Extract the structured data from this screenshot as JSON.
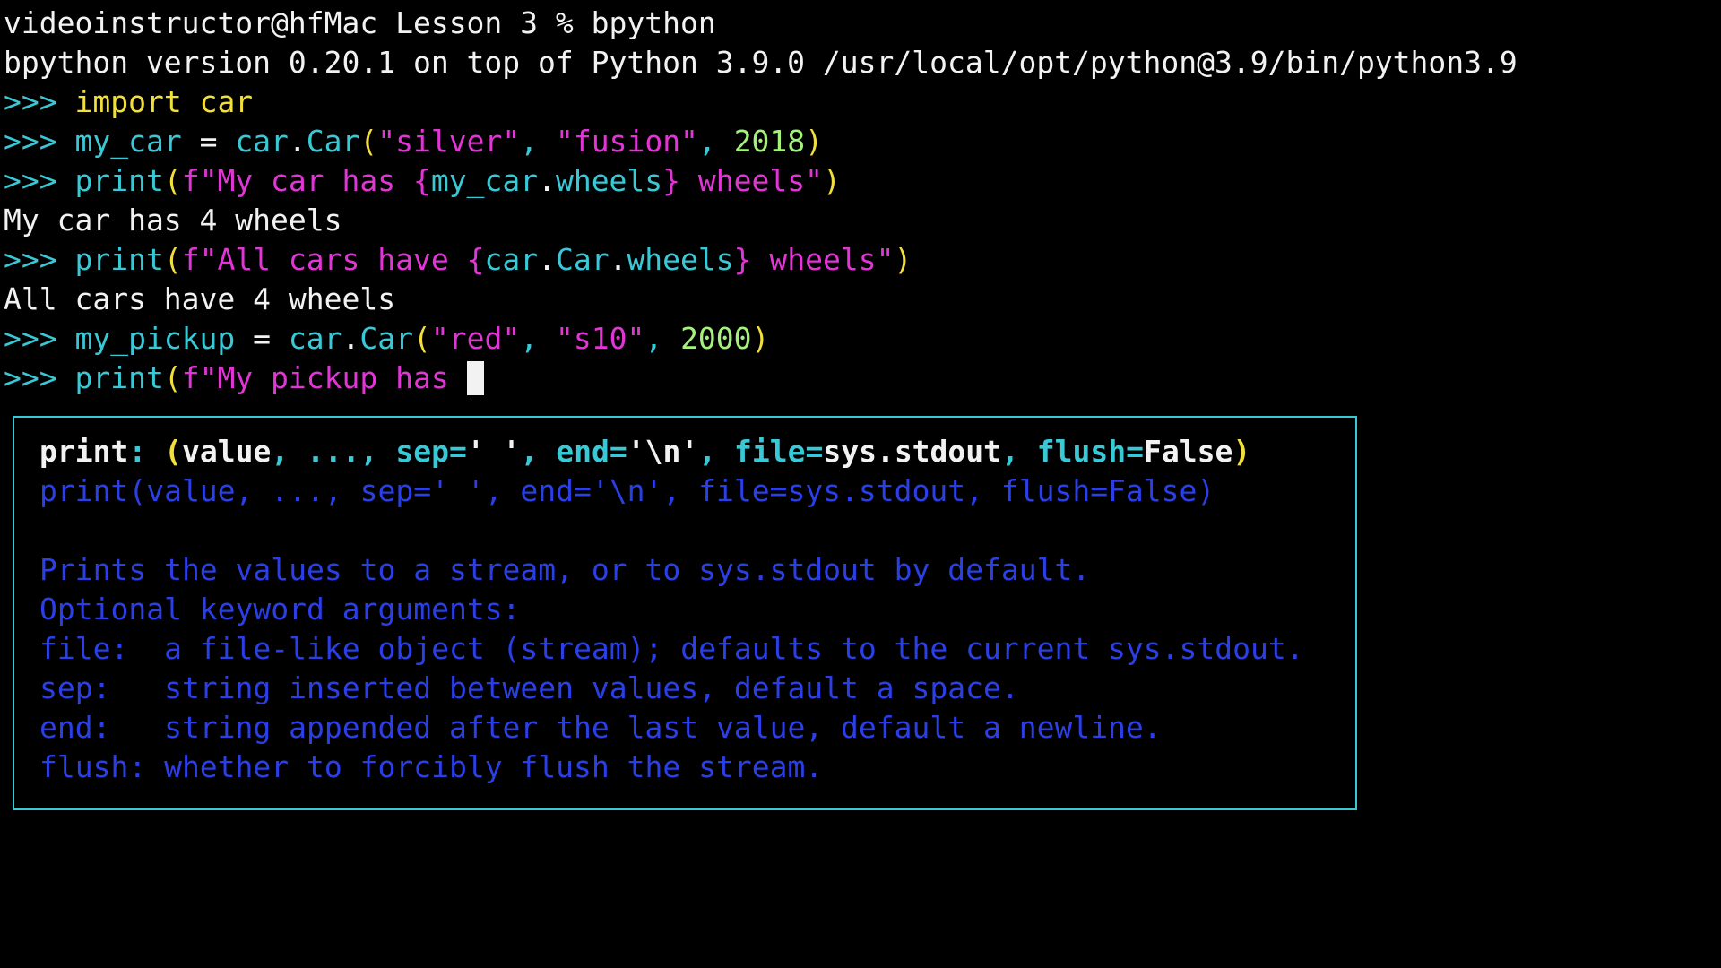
{
  "terminal": {
    "shell_prompt": "videoinstructor@hfMac Lesson 3 % ",
    "shell_command": "bpython",
    "version_line": "bpython version 0.20.1 on top of Python 3.9.0 /usr/local/opt/python@3.9/bin/python3.9",
    "repl_prompt": ">>> ",
    "lines": [
      {
        "code_import_kw": "import",
        "code_import_mod": " car"
      },
      {
        "var": "my_car",
        "eq": " = ",
        "mod": "car",
        "dot": ".",
        "cls": "Car",
        "open": "(",
        "arg1": "\"silver\"",
        "comma1": ", ",
        "arg2": "\"fusion\"",
        "comma2": ", ",
        "arg3": "2018",
        "close": ")"
      },
      {
        "fn": "print",
        "open": "(",
        "str_start": "f\"My car has ",
        "brace_open": "{",
        "expr_a": "my_car",
        "dot": ".",
        "expr_b": "wheels",
        "brace_close": "}",
        "str_end": " wheels\"",
        "close": ")"
      },
      {
        "output": "My car has 4 wheels"
      },
      {
        "fn": "print",
        "open": "(",
        "str_start": "f\"All cars have ",
        "brace_open": "{",
        "expr_a": "car",
        "dot1": ".",
        "expr_b": "Car",
        "dot2": ".",
        "expr_c": "wheels",
        "brace_close": "}",
        "str_end": " wheels\"",
        "close": ")"
      },
      {
        "output": "All cars have 4 wheels"
      },
      {
        "var": "my_pickup",
        "eq": " = ",
        "mod": "car",
        "dot": ".",
        "cls": "Car",
        "open": "(",
        "arg1": "\"red\"",
        "comma1": ", ",
        "arg2": "\"s10\"",
        "comma2": ", ",
        "arg3": "2000",
        "close": ")"
      },
      {
        "fn": "print",
        "open": "(",
        "str_partial": "f\"My pickup has "
      }
    ]
  },
  "signature_popup": {
    "fn_name": "print",
    "colon": ": ",
    "open": "(",
    "p_value": "value",
    "sep1": ", ",
    "ellipsis": "...",
    "sep2": ", ",
    "p_sep": "sep",
    "eq1": "=",
    "v_sep": "' '",
    "sep3": ", ",
    "p_end": "end",
    "eq2": "=",
    "v_end": "'\\n'",
    "sep4": ", ",
    "p_file": "file",
    "eq3": "=",
    "v_file": "sys.stdout",
    "sep5": ", ",
    "p_flush": "flush",
    "eq4": "=",
    "v_flush": "False",
    "close": ")",
    "doc_lines": [
      "print(value, ..., sep=' ', end='\\n', file=sys.stdout, flush=False)",
      "",
      "Prints the values to a stream, or to sys.stdout by default.",
      "Optional keyword arguments:",
      "file:  a file-like object (stream); defaults to the current sys.stdout.",
      "sep:   string inserted between values, default a space.",
      "end:   string appended after the last value, default a newline.",
      "flush: whether to forcibly flush the stream."
    ]
  },
  "colors": {
    "background": "#000000",
    "default_text": "#f2f2f2",
    "prompt_cyan": "#39c9d6",
    "keyword_yellow": "#f2df3c",
    "string_magenta": "#e235d6",
    "number_green": "#a3f27a",
    "doc_blue": "#2b3fe6",
    "popup_border": "#39c9d6"
  }
}
